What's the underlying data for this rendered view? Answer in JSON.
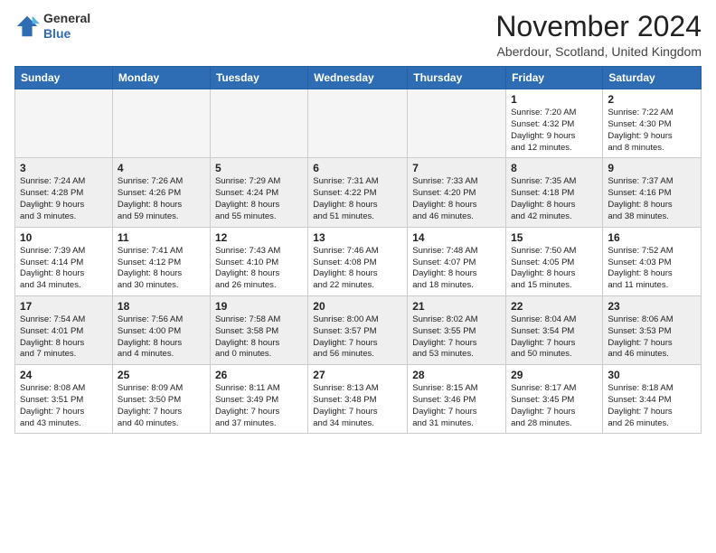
{
  "header": {
    "logo_general": "General",
    "logo_blue": "Blue",
    "month_title": "November 2024",
    "location": "Aberdour, Scotland, United Kingdom"
  },
  "weekdays": [
    "Sunday",
    "Monday",
    "Tuesday",
    "Wednesday",
    "Thursday",
    "Friday",
    "Saturday"
  ],
  "weeks": [
    [
      {
        "day": "",
        "info": ""
      },
      {
        "day": "",
        "info": ""
      },
      {
        "day": "",
        "info": ""
      },
      {
        "day": "",
        "info": ""
      },
      {
        "day": "",
        "info": ""
      },
      {
        "day": "1",
        "info": "Sunrise: 7:20 AM\nSunset: 4:32 PM\nDaylight: 9 hours\nand 12 minutes."
      },
      {
        "day": "2",
        "info": "Sunrise: 7:22 AM\nSunset: 4:30 PM\nDaylight: 9 hours\nand 8 minutes."
      }
    ],
    [
      {
        "day": "3",
        "info": "Sunrise: 7:24 AM\nSunset: 4:28 PM\nDaylight: 9 hours\nand 3 minutes."
      },
      {
        "day": "4",
        "info": "Sunrise: 7:26 AM\nSunset: 4:26 PM\nDaylight: 8 hours\nand 59 minutes."
      },
      {
        "day": "5",
        "info": "Sunrise: 7:29 AM\nSunset: 4:24 PM\nDaylight: 8 hours\nand 55 minutes."
      },
      {
        "day": "6",
        "info": "Sunrise: 7:31 AM\nSunset: 4:22 PM\nDaylight: 8 hours\nand 51 minutes."
      },
      {
        "day": "7",
        "info": "Sunrise: 7:33 AM\nSunset: 4:20 PM\nDaylight: 8 hours\nand 46 minutes."
      },
      {
        "day": "8",
        "info": "Sunrise: 7:35 AM\nSunset: 4:18 PM\nDaylight: 8 hours\nand 42 minutes."
      },
      {
        "day": "9",
        "info": "Sunrise: 7:37 AM\nSunset: 4:16 PM\nDaylight: 8 hours\nand 38 minutes."
      }
    ],
    [
      {
        "day": "10",
        "info": "Sunrise: 7:39 AM\nSunset: 4:14 PM\nDaylight: 8 hours\nand 34 minutes."
      },
      {
        "day": "11",
        "info": "Sunrise: 7:41 AM\nSunset: 4:12 PM\nDaylight: 8 hours\nand 30 minutes."
      },
      {
        "day": "12",
        "info": "Sunrise: 7:43 AM\nSunset: 4:10 PM\nDaylight: 8 hours\nand 26 minutes."
      },
      {
        "day": "13",
        "info": "Sunrise: 7:46 AM\nSunset: 4:08 PM\nDaylight: 8 hours\nand 22 minutes."
      },
      {
        "day": "14",
        "info": "Sunrise: 7:48 AM\nSunset: 4:07 PM\nDaylight: 8 hours\nand 18 minutes."
      },
      {
        "day": "15",
        "info": "Sunrise: 7:50 AM\nSunset: 4:05 PM\nDaylight: 8 hours\nand 15 minutes."
      },
      {
        "day": "16",
        "info": "Sunrise: 7:52 AM\nSunset: 4:03 PM\nDaylight: 8 hours\nand 11 minutes."
      }
    ],
    [
      {
        "day": "17",
        "info": "Sunrise: 7:54 AM\nSunset: 4:01 PM\nDaylight: 8 hours\nand 7 minutes."
      },
      {
        "day": "18",
        "info": "Sunrise: 7:56 AM\nSunset: 4:00 PM\nDaylight: 8 hours\nand 4 minutes."
      },
      {
        "day": "19",
        "info": "Sunrise: 7:58 AM\nSunset: 3:58 PM\nDaylight: 8 hours\nand 0 minutes."
      },
      {
        "day": "20",
        "info": "Sunrise: 8:00 AM\nSunset: 3:57 PM\nDaylight: 7 hours\nand 56 minutes."
      },
      {
        "day": "21",
        "info": "Sunrise: 8:02 AM\nSunset: 3:55 PM\nDaylight: 7 hours\nand 53 minutes."
      },
      {
        "day": "22",
        "info": "Sunrise: 8:04 AM\nSunset: 3:54 PM\nDaylight: 7 hours\nand 50 minutes."
      },
      {
        "day": "23",
        "info": "Sunrise: 8:06 AM\nSunset: 3:53 PM\nDaylight: 7 hours\nand 46 minutes."
      }
    ],
    [
      {
        "day": "24",
        "info": "Sunrise: 8:08 AM\nSunset: 3:51 PM\nDaylight: 7 hours\nand 43 minutes."
      },
      {
        "day": "25",
        "info": "Sunrise: 8:09 AM\nSunset: 3:50 PM\nDaylight: 7 hours\nand 40 minutes."
      },
      {
        "day": "26",
        "info": "Sunrise: 8:11 AM\nSunset: 3:49 PM\nDaylight: 7 hours\nand 37 minutes."
      },
      {
        "day": "27",
        "info": "Sunrise: 8:13 AM\nSunset: 3:48 PM\nDaylight: 7 hours\nand 34 minutes."
      },
      {
        "day": "28",
        "info": "Sunrise: 8:15 AM\nSunset: 3:46 PM\nDaylight: 7 hours\nand 31 minutes."
      },
      {
        "day": "29",
        "info": "Sunrise: 8:17 AM\nSunset: 3:45 PM\nDaylight: 7 hours\nand 28 minutes."
      },
      {
        "day": "30",
        "info": "Sunrise: 8:18 AM\nSunset: 3:44 PM\nDaylight: 7 hours\nand 26 minutes."
      }
    ]
  ]
}
